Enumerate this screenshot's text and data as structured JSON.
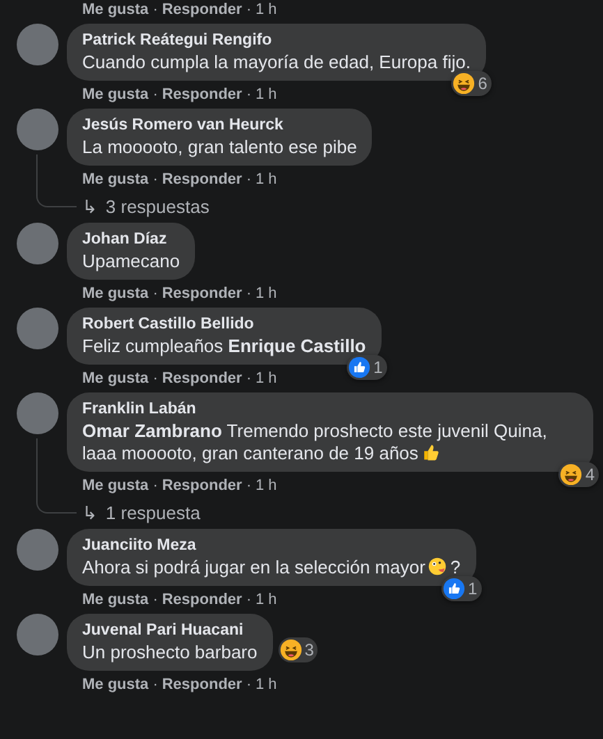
{
  "top_actions": [
    {
      "kind": "link",
      "text": "Me gusta"
    },
    {
      "kind": "sep",
      "text": "·"
    },
    {
      "kind": "link",
      "text": "Responder"
    },
    {
      "kind": "sep",
      "text": "·"
    },
    {
      "kind": "time",
      "text": "1 h"
    }
  ],
  "comments": [
    {
      "author": "Patrick Reátegui Rengifo",
      "parts": [
        {
          "kind": "text",
          "text": "Cuando cumpla la mayoría de edad, Europa fijo."
        }
      ],
      "reaction": {
        "kind": "haha",
        "count": "6"
      },
      "actions": [
        {
          "kind": "link",
          "text": "Me gusta"
        },
        {
          "kind": "sep",
          "text": "·"
        },
        {
          "kind": "link",
          "text": "Responder"
        },
        {
          "kind": "sep",
          "text": "·"
        },
        {
          "kind": "time",
          "text": "1 h"
        }
      ]
    },
    {
      "author": "Jesús Romero van Heurck",
      "parts": [
        {
          "kind": "text",
          "text": "La mooooto, gran talento ese pibe"
        }
      ],
      "actions": [
        {
          "kind": "link",
          "text": "Me gusta"
        },
        {
          "kind": "sep",
          "text": "·"
        },
        {
          "kind": "link",
          "text": "Responder"
        },
        {
          "kind": "sep",
          "text": "·"
        },
        {
          "kind": "time",
          "text": "1 h"
        }
      ],
      "replies": {
        "arrow": "↳",
        "label": "3 respuestas"
      }
    },
    {
      "author": "Johan Díaz",
      "parts": [
        {
          "kind": "text",
          "text": "Upamecano"
        }
      ],
      "actions": [
        {
          "kind": "link",
          "text": "Me gusta"
        },
        {
          "kind": "sep",
          "text": "·"
        },
        {
          "kind": "link",
          "text": "Responder"
        },
        {
          "kind": "sep",
          "text": "·"
        },
        {
          "kind": "time",
          "text": "1 h"
        }
      ]
    },
    {
      "author": "Robert Castillo Bellido",
      "parts": [
        {
          "kind": "text",
          "text": "Feliz cumpleaños **Enrique Castillo**"
        }
      ],
      "reaction": {
        "kind": "like",
        "count": "1"
      },
      "actions": [
        {
          "kind": "link",
          "text": "Me gusta"
        },
        {
          "kind": "sep",
          "text": "·"
        },
        {
          "kind": "link",
          "text": "Responder"
        },
        {
          "kind": "sep",
          "text": "·"
        },
        {
          "kind": "time",
          "text": "1 h"
        }
      ]
    },
    {
      "author": "Franklin Labán",
      "parts": [
        {
          "kind": "text",
          "text": "**Omar Zambrano** Tremendo proshecto este juvenil Quina,"
        },
        {
          "kind": "text",
          "text": "laaa mooooto, gran canterano de 19 años"
        },
        {
          "kind": "thumbs"
        }
      ],
      "reaction": {
        "kind": "haha",
        "count": "4"
      },
      "actions": [
        {
          "kind": "link",
          "text": "Me gusta"
        },
        {
          "kind": "sep",
          "text": "·"
        },
        {
          "kind": "link",
          "text": "Responder"
        },
        {
          "kind": "sep",
          "text": "·"
        },
        {
          "kind": "time",
          "text": "1 h"
        }
      ],
      "replies": {
        "arrow": "↳",
        "label": "1 respuesta"
      }
    },
    {
      "author": "Juanciito Meza",
      "parts": [
        {
          "kind": "text",
          "text": "Ahora si podrá jugar en la selección mayor"
        },
        {
          "kind": "crazy"
        },
        {
          "kind": "text",
          "text": "?"
        }
      ],
      "reaction": {
        "kind": "like",
        "count": "1"
      },
      "actions": [
        {
          "kind": "link",
          "text": "Me gusta"
        },
        {
          "kind": "sep",
          "text": "·"
        },
        {
          "kind": "link",
          "text": "Responder"
        },
        {
          "kind": "sep",
          "text": "·"
        },
        {
          "kind": "time",
          "text": "1 h"
        }
      ]
    },
    {
      "author": "Juvenal Pari Huacani",
      "parts": [
        {
          "kind": "text",
          "text": "Un proshecto barbaro"
        }
      ],
      "reaction_beside": {
        "kind": "haha",
        "count": "3"
      },
      "actions": [
        {
          "kind": "link",
          "text": "Me gusta"
        },
        {
          "kind": "sep",
          "text": "·"
        },
        {
          "kind": "link",
          "text": "Responder"
        },
        {
          "kind": "sep",
          "text": "·"
        },
        {
          "kind": "time",
          "text": "1 h"
        }
      ]
    }
  ]
}
